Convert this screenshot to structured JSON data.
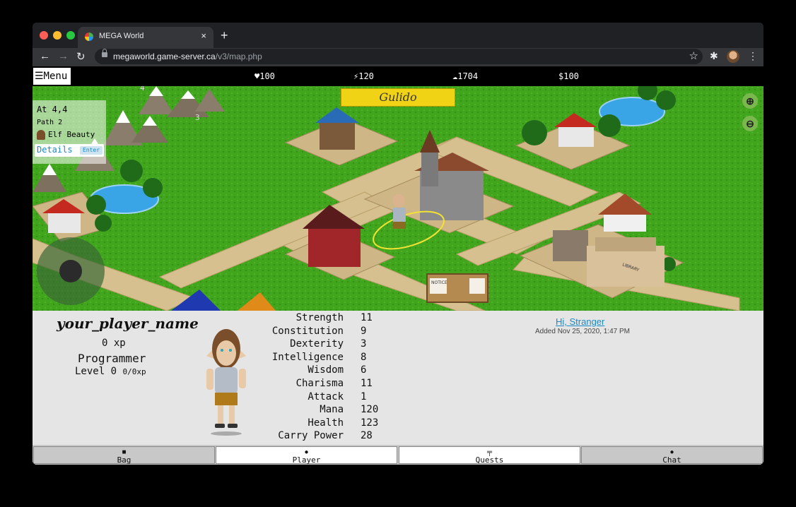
{
  "browser": {
    "tab_title": "MEGA World",
    "tab_close": "×",
    "new_tab": "+",
    "url_host": "megaworld.game-server.ca",
    "url_path": "/v3/map.php"
  },
  "hud": {
    "menu_label": "☰Menu",
    "hearts": "100",
    "energy": "120",
    "food": "1704",
    "money": "$100"
  },
  "map": {
    "banner": "Gulido",
    "location": "At 4,4",
    "path": "Path 2",
    "companion": "Elf Beauty",
    "details": "Details",
    "enter": "Enter",
    "tile_3": "3",
    "tile_4": "4",
    "notice": "NOTICE",
    "library": "LIBRARY"
  },
  "player": {
    "name": "your_player_name",
    "xp": "0 xp",
    "class": "Programmer",
    "level": "Level 0",
    "level_progress": "0/0xp",
    "stats": [
      {
        "label": "Strength",
        "value": "11"
      },
      {
        "label": "Constitution",
        "value": "9"
      },
      {
        "label": "Dexterity",
        "value": "3"
      },
      {
        "label": "Intelligence",
        "value": "8"
      },
      {
        "label": "Wisdom",
        "value": "6"
      },
      {
        "label": "Charisma",
        "value": "11"
      },
      {
        "label": "Attack",
        "value": "1"
      },
      {
        "label": "Mana",
        "value": "120"
      },
      {
        "label": "Health",
        "value": "123"
      },
      {
        "label": "Carry Power",
        "value": "28"
      }
    ]
  },
  "greeting": {
    "link": "Hi, Stranger",
    "added": "Added Nov 25, 2020, 1:47 PM"
  },
  "tabs": [
    {
      "label": "Bag",
      "icon": "bag-icon"
    },
    {
      "label": "Player",
      "icon": "player-icon"
    },
    {
      "label": "Quests",
      "icon": "signpost-icon"
    },
    {
      "label": "Chat",
      "icon": "chat-icon"
    }
  ]
}
